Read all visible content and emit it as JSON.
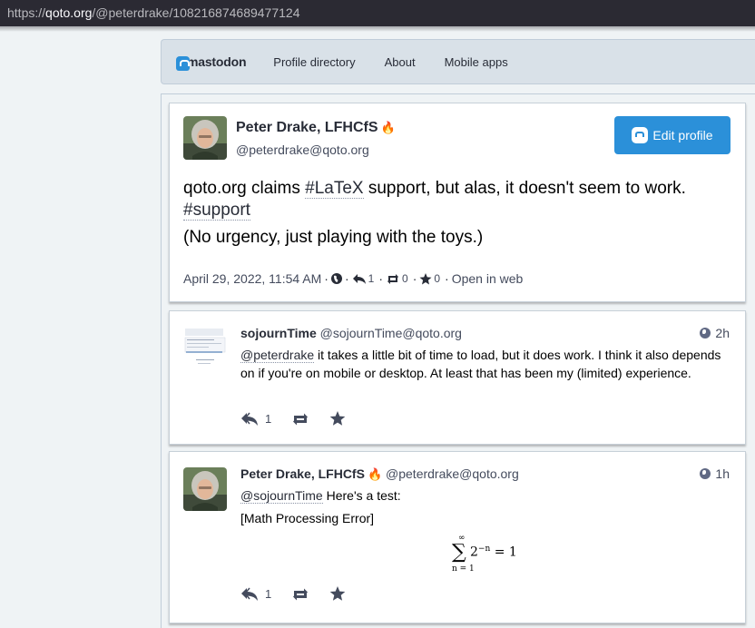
{
  "browser": {
    "url_prefix": "https://",
    "url_host": "qoto.org",
    "url_path": "/@peterdrake/108216874689477124"
  },
  "nav": {
    "logo_text": "mastodon",
    "links": [
      "Profile directory",
      "About",
      "Mobile apps"
    ]
  },
  "main_status": {
    "display_name": "Peter Drake, LFHCfS",
    "emoji": "🔥",
    "acct": "@peterdrake@qoto.org",
    "edit_button": "Edit profile",
    "content": {
      "p1_before": "qoto.org claims ",
      "p1_tag1": "#LaTeX",
      "p1_mid": " support, but alas, it doesn't seem to work. ",
      "p1_tag2": "#support",
      "p2": "(No urgency, just playing with the toys.)"
    },
    "meta": {
      "date": "April 29, 2022, 11:54 AM",
      "sep": "·",
      "replies": "1",
      "reblogs": "0",
      "favourites": "0",
      "open_in_web": "Open in web"
    }
  },
  "replies": [
    {
      "display_name": "sojournTime",
      "acct": "@sojournTime@qoto.org",
      "time": "2h",
      "mention": "@peterdrake",
      "text": " it takes a little bit of time to load, but it does work.  I think it also depends on if you're on mobile or desktop.  At least that has been my (limited) experience.",
      "reply_count": "1"
    },
    {
      "display_name": "Peter Drake, LFHCfS",
      "emoji": "🔥",
      "acct": "@peterdrake@qoto.org",
      "time": "1h",
      "mention": "@sojournTime",
      "text": " Here's a test:",
      "error": "[Math Processing Error]",
      "reply_count": "1",
      "math": {
        "sup": "∞",
        "sigma": "∑",
        "sub": "n = 1",
        "base": "2",
        "exp": "−n",
        "rhs": " = 1"
      }
    }
  ],
  "colors": {
    "accent": "#2b90d9",
    "nav_bg": "#d9e1e8",
    "page_bg": "#eff3f5",
    "text": "#282c37",
    "muted": "#444b5d"
  },
  "icons": {
    "reply": "reply-icon",
    "reblog": "retweet-icon",
    "favourite": "star-icon",
    "visibility": "globe-icon"
  }
}
